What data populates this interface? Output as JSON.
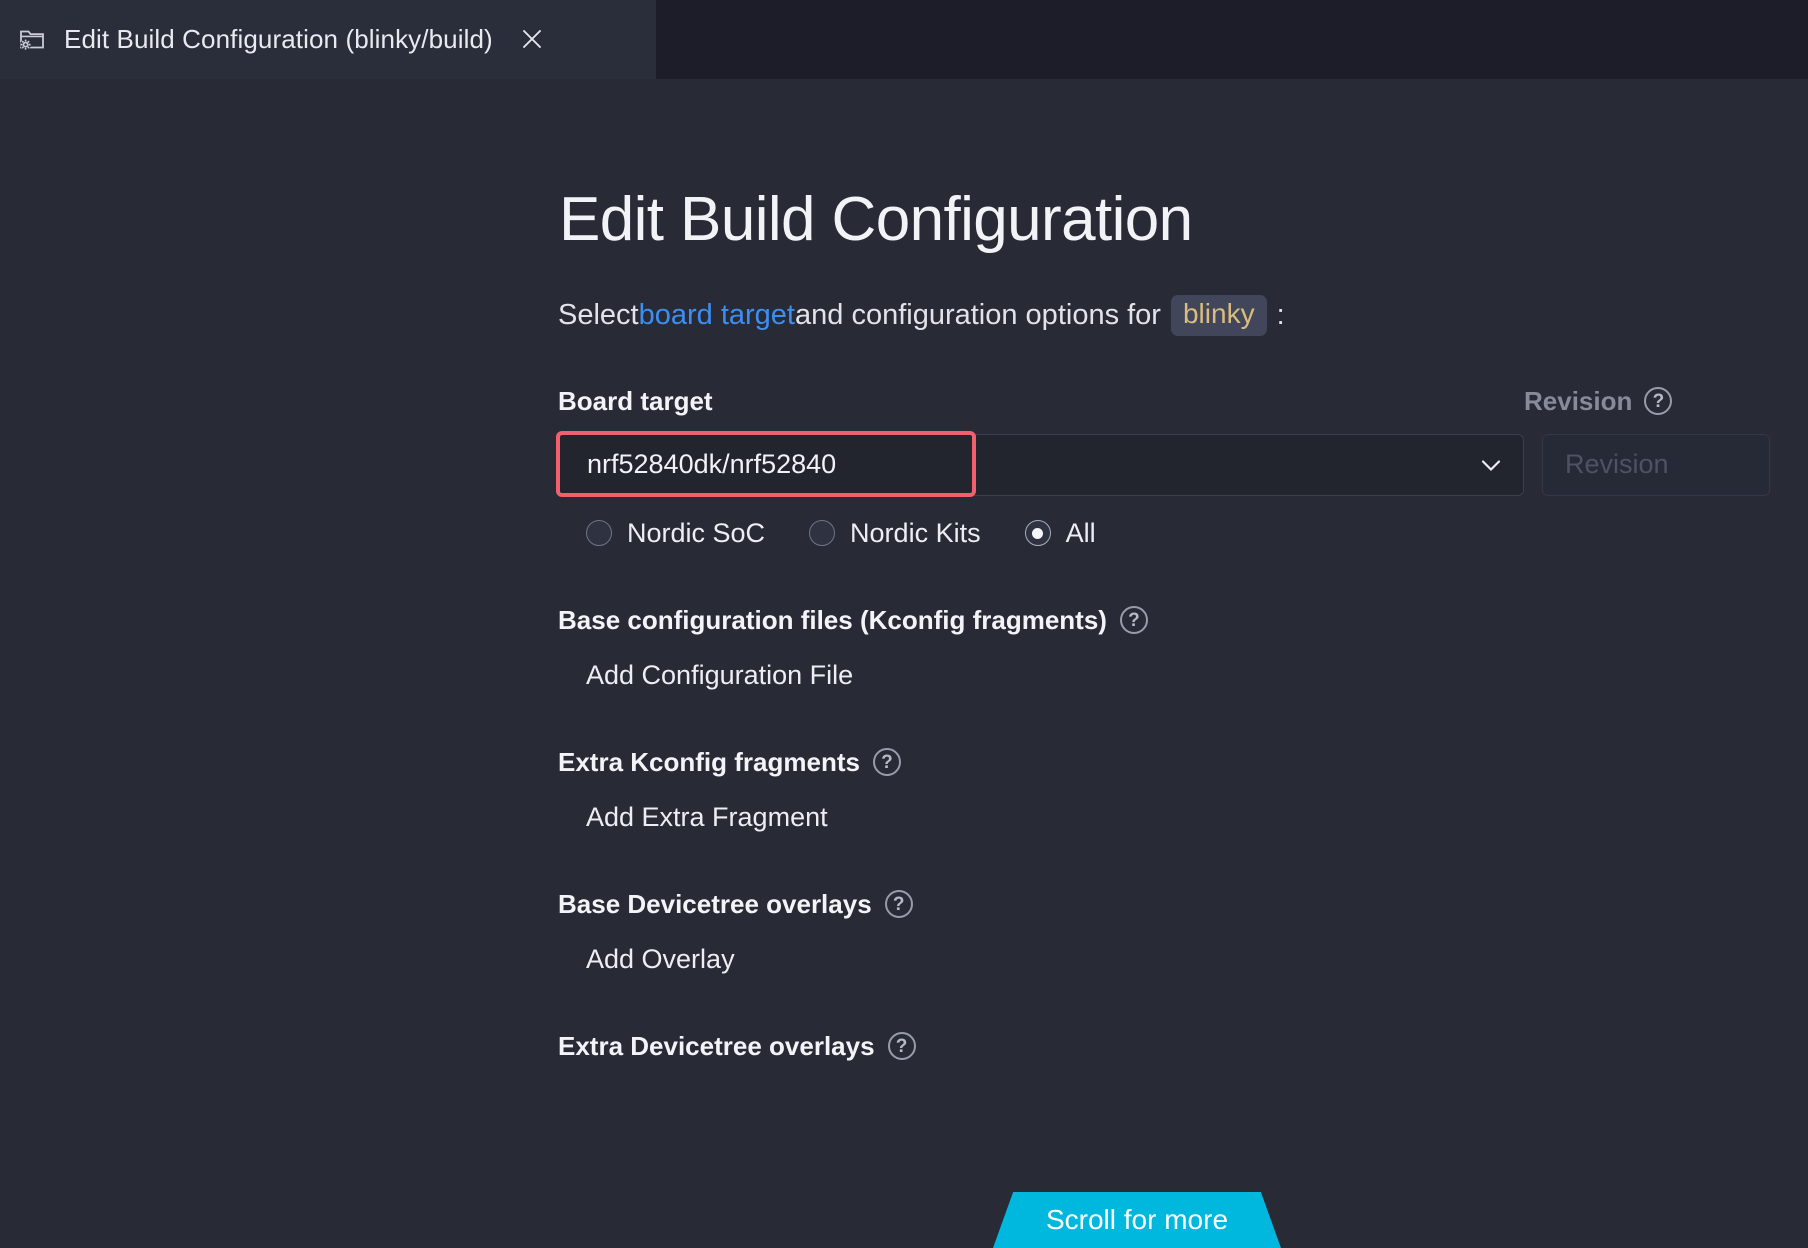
{
  "tab": {
    "icon": "folder-gear-icon",
    "title": "Edit Build Configuration (blinky/build)",
    "close_label": "×"
  },
  "page": {
    "title": "Edit Build Configuration",
    "subtitle": {
      "prefix": "Select ",
      "link": "board target",
      "middle": " and configuration options for ",
      "chip": "blinky",
      "suffix": ":"
    }
  },
  "board_target": {
    "label": "Board target",
    "value": "nrf52840dk/nrf52840",
    "chevron": "chevron-down-icon",
    "annotation_color": "#f2606e"
  },
  "revision": {
    "label": "Revision",
    "placeholder": "Revision",
    "help": "?"
  },
  "filters": {
    "options": [
      {
        "label": "Nordic SoC",
        "selected": false
      },
      {
        "label": "Nordic Kits",
        "selected": false
      },
      {
        "label": "All",
        "selected": true
      }
    ]
  },
  "sections": [
    {
      "title": "Base configuration files (Kconfig fragments)",
      "help": "?",
      "action": "Add Configuration File"
    },
    {
      "title": "Extra Kconfig fragments",
      "help": "?",
      "action": "Add Extra Fragment"
    },
    {
      "title": "Base Devicetree overlays",
      "help": "?",
      "action": "Add Overlay"
    },
    {
      "title": "Extra Devicetree overlays",
      "help": "?",
      "action": ""
    }
  ],
  "scroll_hint": {
    "label": "Scroll for more",
    "color": "#00b8de"
  },
  "colors": {
    "background": "#282b36",
    "tabbar": "#1c1d28",
    "tab_active": "#2a2d3a",
    "link": "#3e8ef0",
    "chip_text": "#d9bd80",
    "chip_bg": "#41465a",
    "accent": "#00b8de",
    "annotation": "#f2606e"
  }
}
